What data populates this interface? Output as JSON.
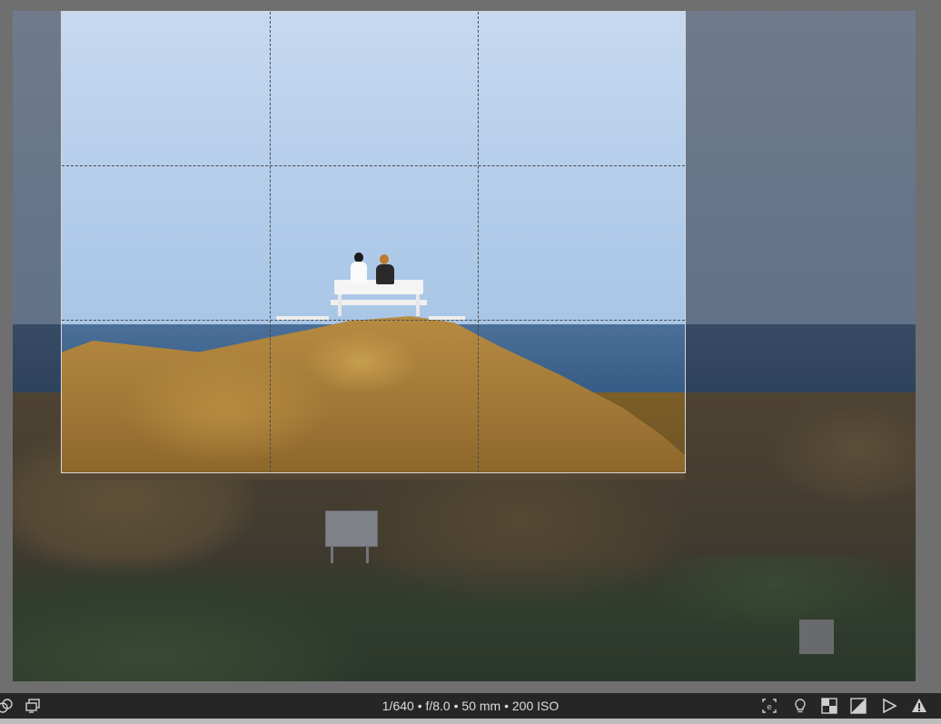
{
  "statusbar": {
    "exif": "1/640 • f/8.0 • 50 mm • 200 ISO"
  },
  "icons": {
    "left": [
      "overlap-circles-icon",
      "second-display-icon"
    ],
    "right": [
      "focus-detection-icon",
      "lightbulb-icon",
      "checkerboard-icon",
      "clipping-indicator-icon",
      "soft-proof-icon",
      "warning-icon"
    ]
  },
  "photo": {
    "description_visible": "coastal rocks with bench",
    "sign_text": ""
  },
  "crop": {
    "grid": "rule-of-thirds"
  }
}
